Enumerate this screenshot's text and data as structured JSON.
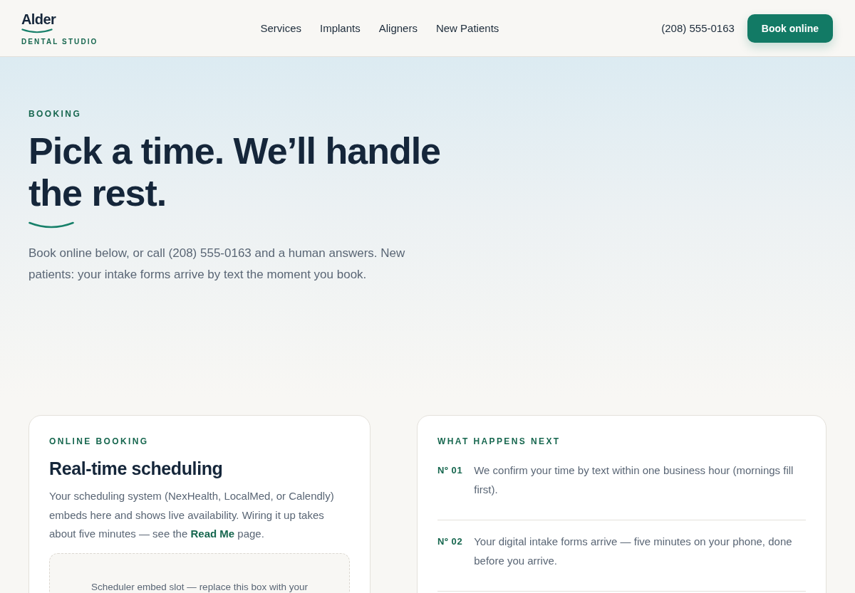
{
  "header": {
    "logo": {
      "name": "Alder",
      "tagline": "DENTAL STUDIO"
    },
    "nav": [
      {
        "label": "Services"
      },
      {
        "label": "Implants"
      },
      {
        "label": "Aligners"
      },
      {
        "label": "New Patients"
      }
    ],
    "phone": "(208) 555-0163",
    "cta": "Book online"
  },
  "hero": {
    "eyebrow": "BOOKING",
    "title": "Pick a time. We’ll handle the rest.",
    "intro": "Book online below, or call (208) 555-0163 and a human answers. New patients: your intake forms arrive by text the moment you book."
  },
  "booking_card": {
    "eyebrow": "ONLINE BOOKING",
    "title": "Real-time scheduling",
    "body": [
      {
        "kind": "text",
        "text": "Your scheduling system (NexHealth, LocalMed, or Calendly) embeds here and shows live availability. Wiring it up takes about five minutes — see the"
      },
      {
        "kind": "link",
        "text": "Read Me"
      },
      {
        "kind": "text",
        "text": "page."
      }
    ],
    "embed_slot": "Scheduler embed slot — replace this box with your"
  },
  "next_steps": {
    "eyebrow": "WHAT HAPPENS NEXT",
    "steps": [
      {
        "number": "Nº 01",
        "text": "We confirm your time by text within one business hour (mornings fill first)."
      },
      {
        "number": "Nº 02",
        "text": "Your digital intake forms arrive — five minutes on your phone, done before you arrive."
      }
    ]
  }
}
